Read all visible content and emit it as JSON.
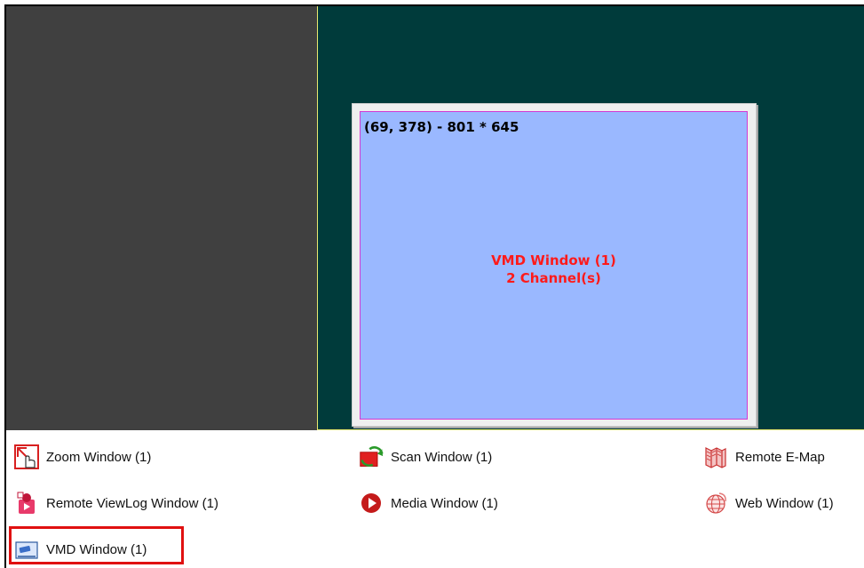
{
  "canvas": {
    "coords_label": "(69, 378) - 801 * 645",
    "window_title": "VMD Window (1)",
    "window_subtitle": "2 Channel(s)"
  },
  "menu_items": [
    {
      "label": "Zoom Window (1)",
      "icon": "zoom-window-icon"
    },
    {
      "label": "Scan Window (1)",
      "icon": "scan-window-icon"
    },
    {
      "label": "Remote E-Map",
      "icon": "remote-emap-icon"
    },
    {
      "label": "Remote ViewLog Window (1)",
      "icon": "remote-viewlog-icon"
    },
    {
      "label": "Media Window (1)",
      "icon": "media-window-icon"
    },
    {
      "label": "Web Window (1)",
      "icon": "web-window-icon"
    },
    {
      "label": "VMD Window (1)",
      "icon": "vmd-window-icon"
    }
  ],
  "colors": {
    "left_pane": "#404040",
    "right_pane": "#003b3b",
    "canvas_fill": "#9ab8ff",
    "canvas_border": "#d33ad3",
    "label_red": "#ff1a1a",
    "highlight": "#e01010"
  }
}
